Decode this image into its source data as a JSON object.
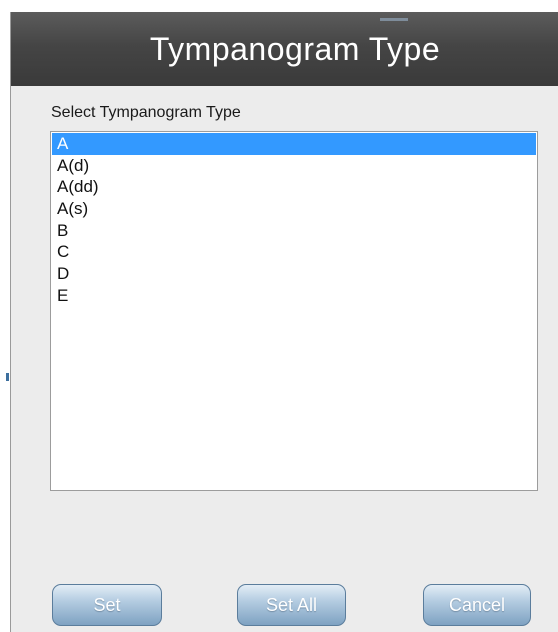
{
  "dialog": {
    "title": "Tympanogram Type",
    "list_label": "Select Tympanogram Type",
    "items": [
      "A",
      "A(d)",
      "A(dd)",
      "A(s)",
      "B",
      "C",
      "D",
      "E"
    ],
    "selected_item": "A",
    "buttons": {
      "set": "Set",
      "set_all": "Set All",
      "cancel": "Cancel"
    }
  },
  "colors": {
    "title_bar": "#454545",
    "selection": "#3399ff",
    "button": "#9fbbd6"
  }
}
